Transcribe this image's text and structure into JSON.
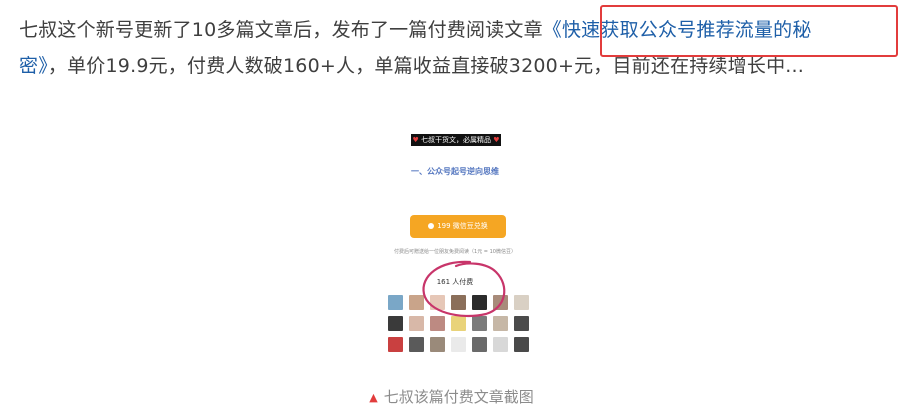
{
  "article": {
    "line1_prefix": "七叔这个新号更新了10多篇文章后，发布了一篇付费阅读文章",
    "line1_link": "《快速获取公众号推荐流量的秘",
    "line2_link": "密》",
    "line2_text": "，单价19.9元，付费人数破160+人，单篇收益直接破3200+元，目前还在持续增长中..."
  },
  "screenshot": {
    "badge_text": "七叔干货文，必属精品",
    "heading": "一、公众号起号逆向思维",
    "pay_button_label": "199 微信豆兑换",
    "pay_note": "付费后可赠送给一位朋友免费阅读（1元 = 10微信豆）",
    "payers_count": "161 人付费",
    "avatar_colors": [
      "#7aa7c7",
      "#c9a48a",
      "#e6c7b7",
      "#8b6f5a",
      "#2b2b2b",
      "#a88b7a",
      "#d9d0c4",
      "#3a3a3a",
      "#d8b8a8",
      "#bd8a82",
      "#e9d37a",
      "#7b7b7b",
      "#c6b7a6",
      "#4b4b4b",
      "#c94040",
      "#5a5a5a",
      "#9a8a7a",
      "#eaeaea",
      "#6a6a6a",
      "#d8d8d8",
      "#4a4a4a"
    ]
  },
  "caption": {
    "icon": "triangle-up-icon",
    "text": "七叔该篇付费文章截图"
  },
  "colors": {
    "link": "#1e5fa8",
    "highlight_box": "#e23c3c",
    "circle_mark": "#c8356a",
    "pay_button": "#f5a623"
  }
}
